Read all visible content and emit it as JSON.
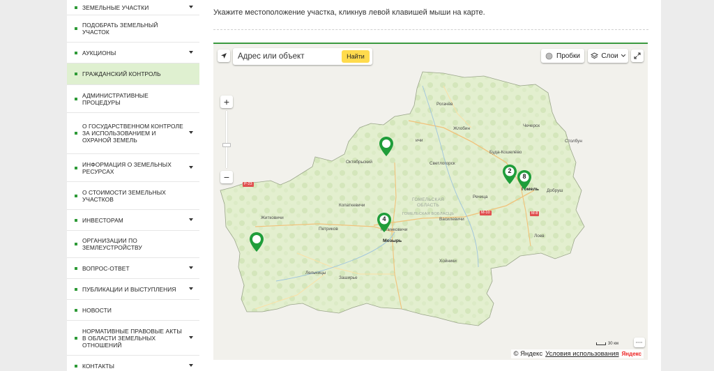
{
  "sidebar": {
    "items": [
      {
        "label": "ЗЕМЕЛЬНЫЕ УЧАСТКИ",
        "dropdown": true
      },
      {
        "label": "ПОДОБРАТЬ ЗЕМЕЛЬНЫЙ УЧАСТОК",
        "dropdown": false
      },
      {
        "label": "АУКЦИОНЫ",
        "dropdown": true
      },
      {
        "label": "ГРАЖДАНСКИЙ КОНТРОЛЬ",
        "dropdown": false,
        "active": true
      },
      {
        "label": "АДМИНИСТРАТИВНЫЕ ПРОЦЕДУРЫ",
        "dropdown": false
      },
      {
        "label": "О ГОСУДАРСТВЕННОМ КОНТРОЛЕ ЗА ИСПОЛЬЗОВАНИЕМ И ОХРАНОЙ ЗЕМЕЛЬ",
        "dropdown": true
      },
      {
        "label": "ИНФОРМАЦИЯ О ЗЕМЕЛЬНЫХ РЕСУРСАХ",
        "dropdown": true
      },
      {
        "label": "О СТОИМОСТИ ЗЕМЕЛЬНЫХ УЧАСТКОВ",
        "dropdown": false
      },
      {
        "label": "ИНВЕСТОРАМ",
        "dropdown": true
      },
      {
        "label": "ОРГАНИЗАЦИИ ПО ЗЕМЛЕУСТРОЙСТВУ",
        "dropdown": false
      },
      {
        "label": "ВОПРОС-ОТВЕТ",
        "dropdown": true
      },
      {
        "label": "ПУБЛИКАЦИИ И ВЫСТУПЛЕНИЯ",
        "dropdown": true
      },
      {
        "label": "НОВОСТИ",
        "dropdown": false
      },
      {
        "label": "НОРМАТИВНЫЕ ПРАВОВЫЕ АКТЫ В ОБЛАСТИ ЗЕМЕЛЬНЫХ ОТНОШЕНИЙ",
        "dropdown": true
      },
      {
        "label": "КОНТАКТЫ",
        "dropdown": true
      }
    ],
    "accent": "#2e9a37",
    "active_bg": "#dff0d0"
  },
  "main": {
    "instruction": "Укажите местоположение участка, кликнув левой клавишей мыши на карте."
  },
  "map": {
    "search": {
      "placeholder": "Адрес или объект",
      "button": "Найти"
    },
    "traffic_label": "Пробки",
    "layers_label": "Слои",
    "zoom_in": "+",
    "zoom_out": "−",
    "region_label": "ГОМЕЛЬСКАЯ ОБЛАСТЬ",
    "region_label_local": "ГОМЕЛЬСКАЯ ВОБЛАСЦЬ",
    "cities": {
      "rogachev": "Рогачёв",
      "zhlobin": "Жлобин",
      "chechersk": "Чечерск",
      "stolbun": "Столбун",
      "buda": "Буда-Кошелёво",
      "oktyabrsky": "Октябрьский",
      "svetlogorsk": "Светлогорск",
      "gomel": "Гомель",
      "dobrush": "Добруш",
      "rechitsa": "Речица",
      "kopatkevichi": "Копаткевичи",
      "zhitkovichi": "Житковичи",
      "petrikov": "Петриков",
      "kalinkovichi": "Калинковичи",
      "mozyr": "Мозырь",
      "vasilevichi": "Василевичи",
      "loev": "Лоев",
      "khoyniki": "Хойники",
      "lelchitsy": "Лельчицы",
      "zashirye": "Заширье",
      "zhatsy": "ичи"
    },
    "roads": {
      "r1": "Р-23",
      "r2": "М-10",
      "r3": "М-8"
    },
    "markers": [
      {
        "label": ""
      },
      {
        "label": "4"
      },
      {
        "label": "2"
      },
      {
        "label": "8"
      },
      {
        "label": ""
      }
    ],
    "marker_color": "#1f9d3a",
    "scale_label": "30 км",
    "copyright": "© Яндекс",
    "terms": "Условия использования",
    "brand": "Яндекс"
  }
}
